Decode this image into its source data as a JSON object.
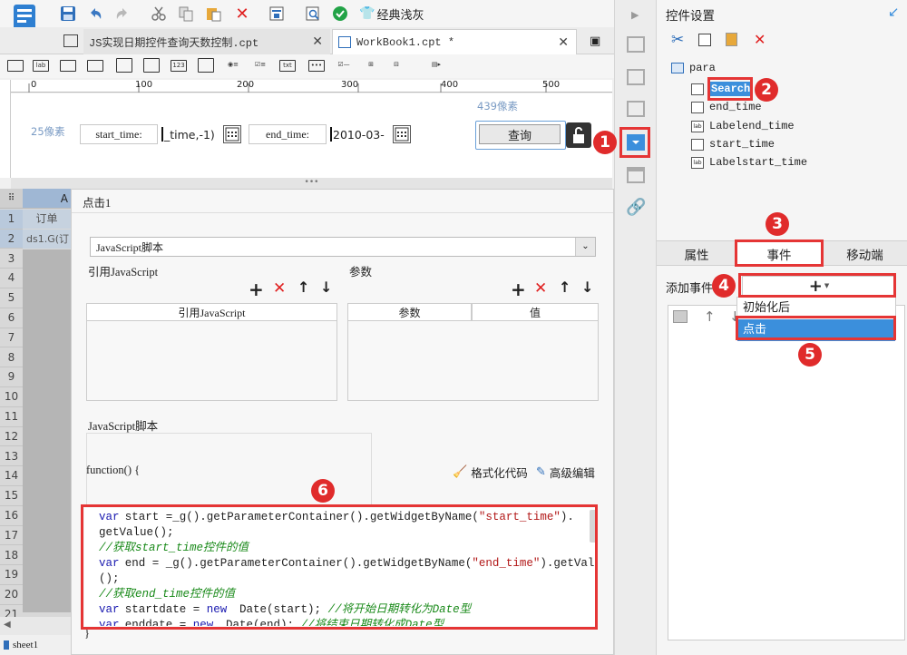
{
  "toolbar": {
    "theme_label": "经典浅灰"
  },
  "tabs": [
    {
      "label": "JS实现日期控件查询天数控制.cpt"
    },
    {
      "label": "WorkBook1.cpt *"
    }
  ],
  "widget_icons": [
    "lab",
    "123",
    "txt"
  ],
  "ruler": {
    "ticks": [
      "0",
      "100",
      "200",
      "300",
      "400",
      "500"
    ]
  },
  "design": {
    "left_px_label": "25像素",
    "right_px_label": "439像素",
    "start_label": "start_time:",
    "start_value": "_time,-1)",
    "end_label": "end_time:",
    "end_value": "2010-03-",
    "query_button": "查询"
  },
  "sheet": {
    "col_a": "A",
    "rows": [
      "1",
      "2",
      "3",
      "4",
      "5",
      "6",
      "7",
      "8",
      "9",
      "10",
      "11",
      "12",
      "13",
      "14",
      "15",
      "16",
      "17",
      "18",
      "19",
      "20",
      "21"
    ],
    "cell_a1": "订单",
    "cell_a2": "ds1.G(订",
    "tab_name": "sheet1"
  },
  "dialog": {
    "title": "点击1",
    "type_select": "JavaScript脚本",
    "ref_js_label": "引用JavaScript",
    "params_label": "参数",
    "ref_js_col": "引用JavaScript",
    "params_col": "参数",
    "value_col": "值",
    "script_label": "JavaScript脚本",
    "function_head": "function() {",
    "format_code": "格式化代码",
    "advanced_edit": "高级编辑",
    "closing_brace": "}",
    "code_lines": [
      {
        "parts": [
          [
            "kw",
            "var"
          ],
          [
            "",
            "start ="
          ],
          [
            "",
            "_g"
          ],
          [
            "",
            ""
          ],
          [
            "",
            "().getParameterContainer().getWidgetByName("
          ],
          [
            "str",
            "\"start_time\""
          ],
          [
            "",
            ")."
          ]
        ]
      },
      {
        "parts": [
          [
            "",
            "getValue();"
          ]
        ]
      },
      {
        "parts": [
          [
            "cmt",
            "//获取start_time控件的值"
          ]
        ]
      },
      {
        "parts": [
          [
            "kw",
            "var"
          ],
          [
            "",
            "end = _g().getParameterContainer().getWidgetByName("
          ],
          [
            "str",
            "\"end_time\""
          ],
          [
            "",
            ").getValue"
          ]
        ]
      },
      {
        "parts": [
          [
            "",
            "();"
          ]
        ]
      },
      {
        "parts": [
          [
            "cmt",
            "//获取end_time控件的值"
          ]
        ]
      },
      {
        "parts": [
          [
            "kw",
            "var"
          ],
          [
            "",
            "startdate = "
          ],
          [
            "kw",
            "new"
          ],
          [
            "",
            " Date(start); "
          ],
          [
            "cmt",
            "//将开始日期转化为Date型"
          ]
        ]
      },
      {
        "parts": [
          [
            "kw",
            "var"
          ],
          [
            "",
            "enddate = "
          ],
          [
            "kw",
            "new"
          ],
          [
            "",
            " Date(end); "
          ],
          [
            "cmt",
            "//将结束日期转化成Date型"
          ]
        ]
      }
    ]
  },
  "right": {
    "title": "控件设置",
    "tree_root": "para",
    "tree_items": [
      "Search",
      "end_time",
      "Labelend_time",
      "start_time",
      "Labelstart_time"
    ],
    "tabs": [
      "属性",
      "事件",
      "移动端"
    ],
    "add_event_label": "添加事件",
    "dropdown_items": [
      "初始化后",
      "点击"
    ]
  },
  "badges": [
    "1",
    "2",
    "3",
    "4",
    "5",
    "6"
  ],
  "colors": {
    "accent": "#3b8fdc",
    "annotation": "#e53535",
    "selected": "#3b8fdc"
  }
}
